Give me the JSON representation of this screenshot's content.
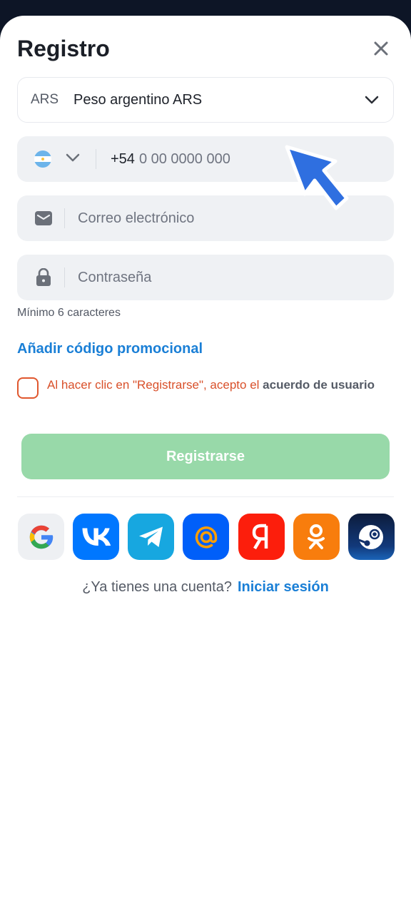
{
  "header": {
    "title": "Registro"
  },
  "currency": {
    "code": "ARS",
    "name": "Peso argentino ARS"
  },
  "phone": {
    "prefix": "+54",
    "placeholder": "0 00 0000 000"
  },
  "email": {
    "placeholder": "Correo electrónico"
  },
  "password": {
    "placeholder": "Contraseña",
    "hint": "Mínimo 6 caracteres"
  },
  "promo": {
    "label": "Añadir código promocional"
  },
  "agreement": {
    "text": "Al hacer clic en \"Registrarse\", acepto el ",
    "link": "acuerdo de usuario"
  },
  "submit": {
    "label": "Registrarse"
  },
  "socials": [
    "google-icon",
    "vk-icon",
    "telegram-icon",
    "mailru-icon",
    "yandex-icon",
    "odnoklassniki-icon",
    "steam-icon"
  ],
  "login": {
    "question": "¿Ya tienes una cuenta?",
    "link": "Iniciar sesión"
  },
  "colors": {
    "accent": "#1a7fd6",
    "submit_disabled": "#98d9a9",
    "error": "#d9502a",
    "cursor": "#2f6fe0"
  }
}
